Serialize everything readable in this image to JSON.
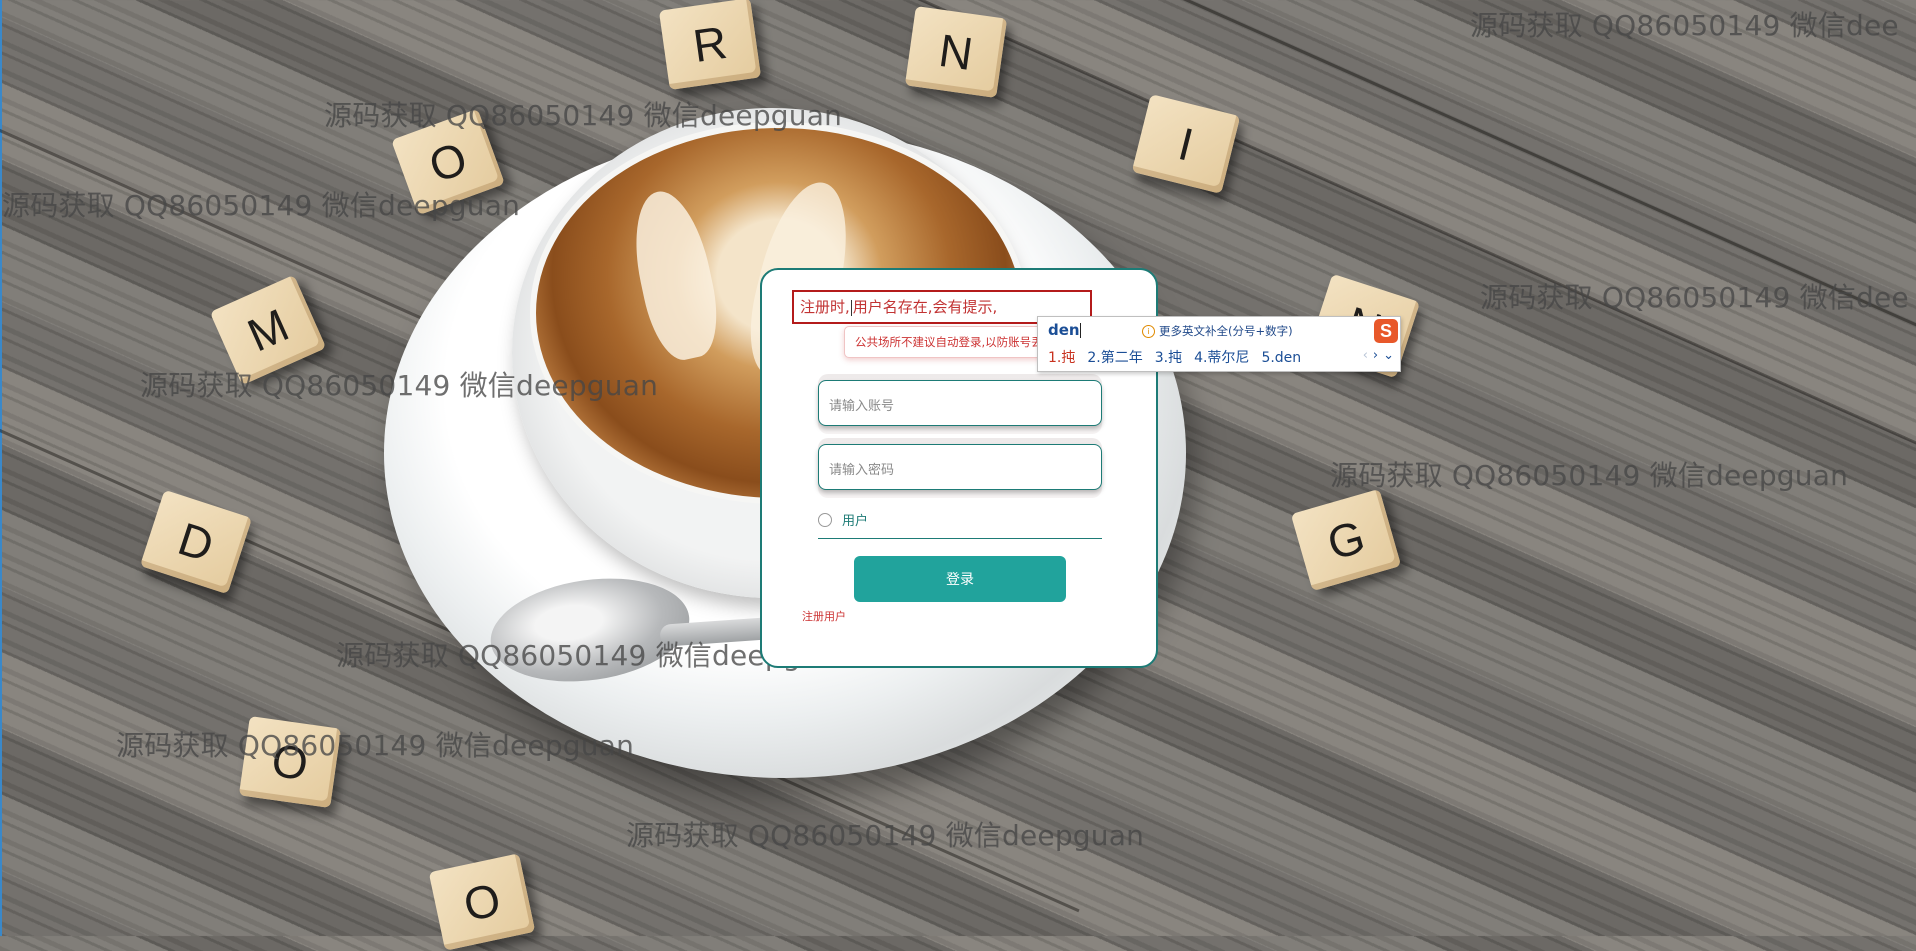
{
  "background": {
    "tiles": [
      "R",
      "N",
      "O",
      "I",
      "M",
      "N",
      "D",
      "G",
      "O",
      "O"
    ],
    "watermark_text": "源码获取 QQ86050149 微信deepguan",
    "watermark_partial": "源码获取 QQ86050149 微信dee"
  },
  "login": {
    "notice_before": "注册时,",
    "notice_after": "用户名存在,会有提示,",
    "tooltip": "公共场所不建议自动登录,以防账号丢失",
    "account_placeholder": "请输入账号",
    "password_placeholder": "请输入密码",
    "role_label": "用户",
    "login_button": "登录",
    "register_link": "注册用户"
  },
  "ime": {
    "input": "den",
    "hint": "更多英文补全(分号+数字)",
    "candidates": [
      "1.扽",
      "2.第二年",
      "3.扽",
      "4.蒂尔尼",
      "5.den"
    ],
    "logo": "S"
  },
  "colors": {
    "accent": "#1d7b76",
    "button": "#21a39c",
    "error": "#c23333"
  }
}
